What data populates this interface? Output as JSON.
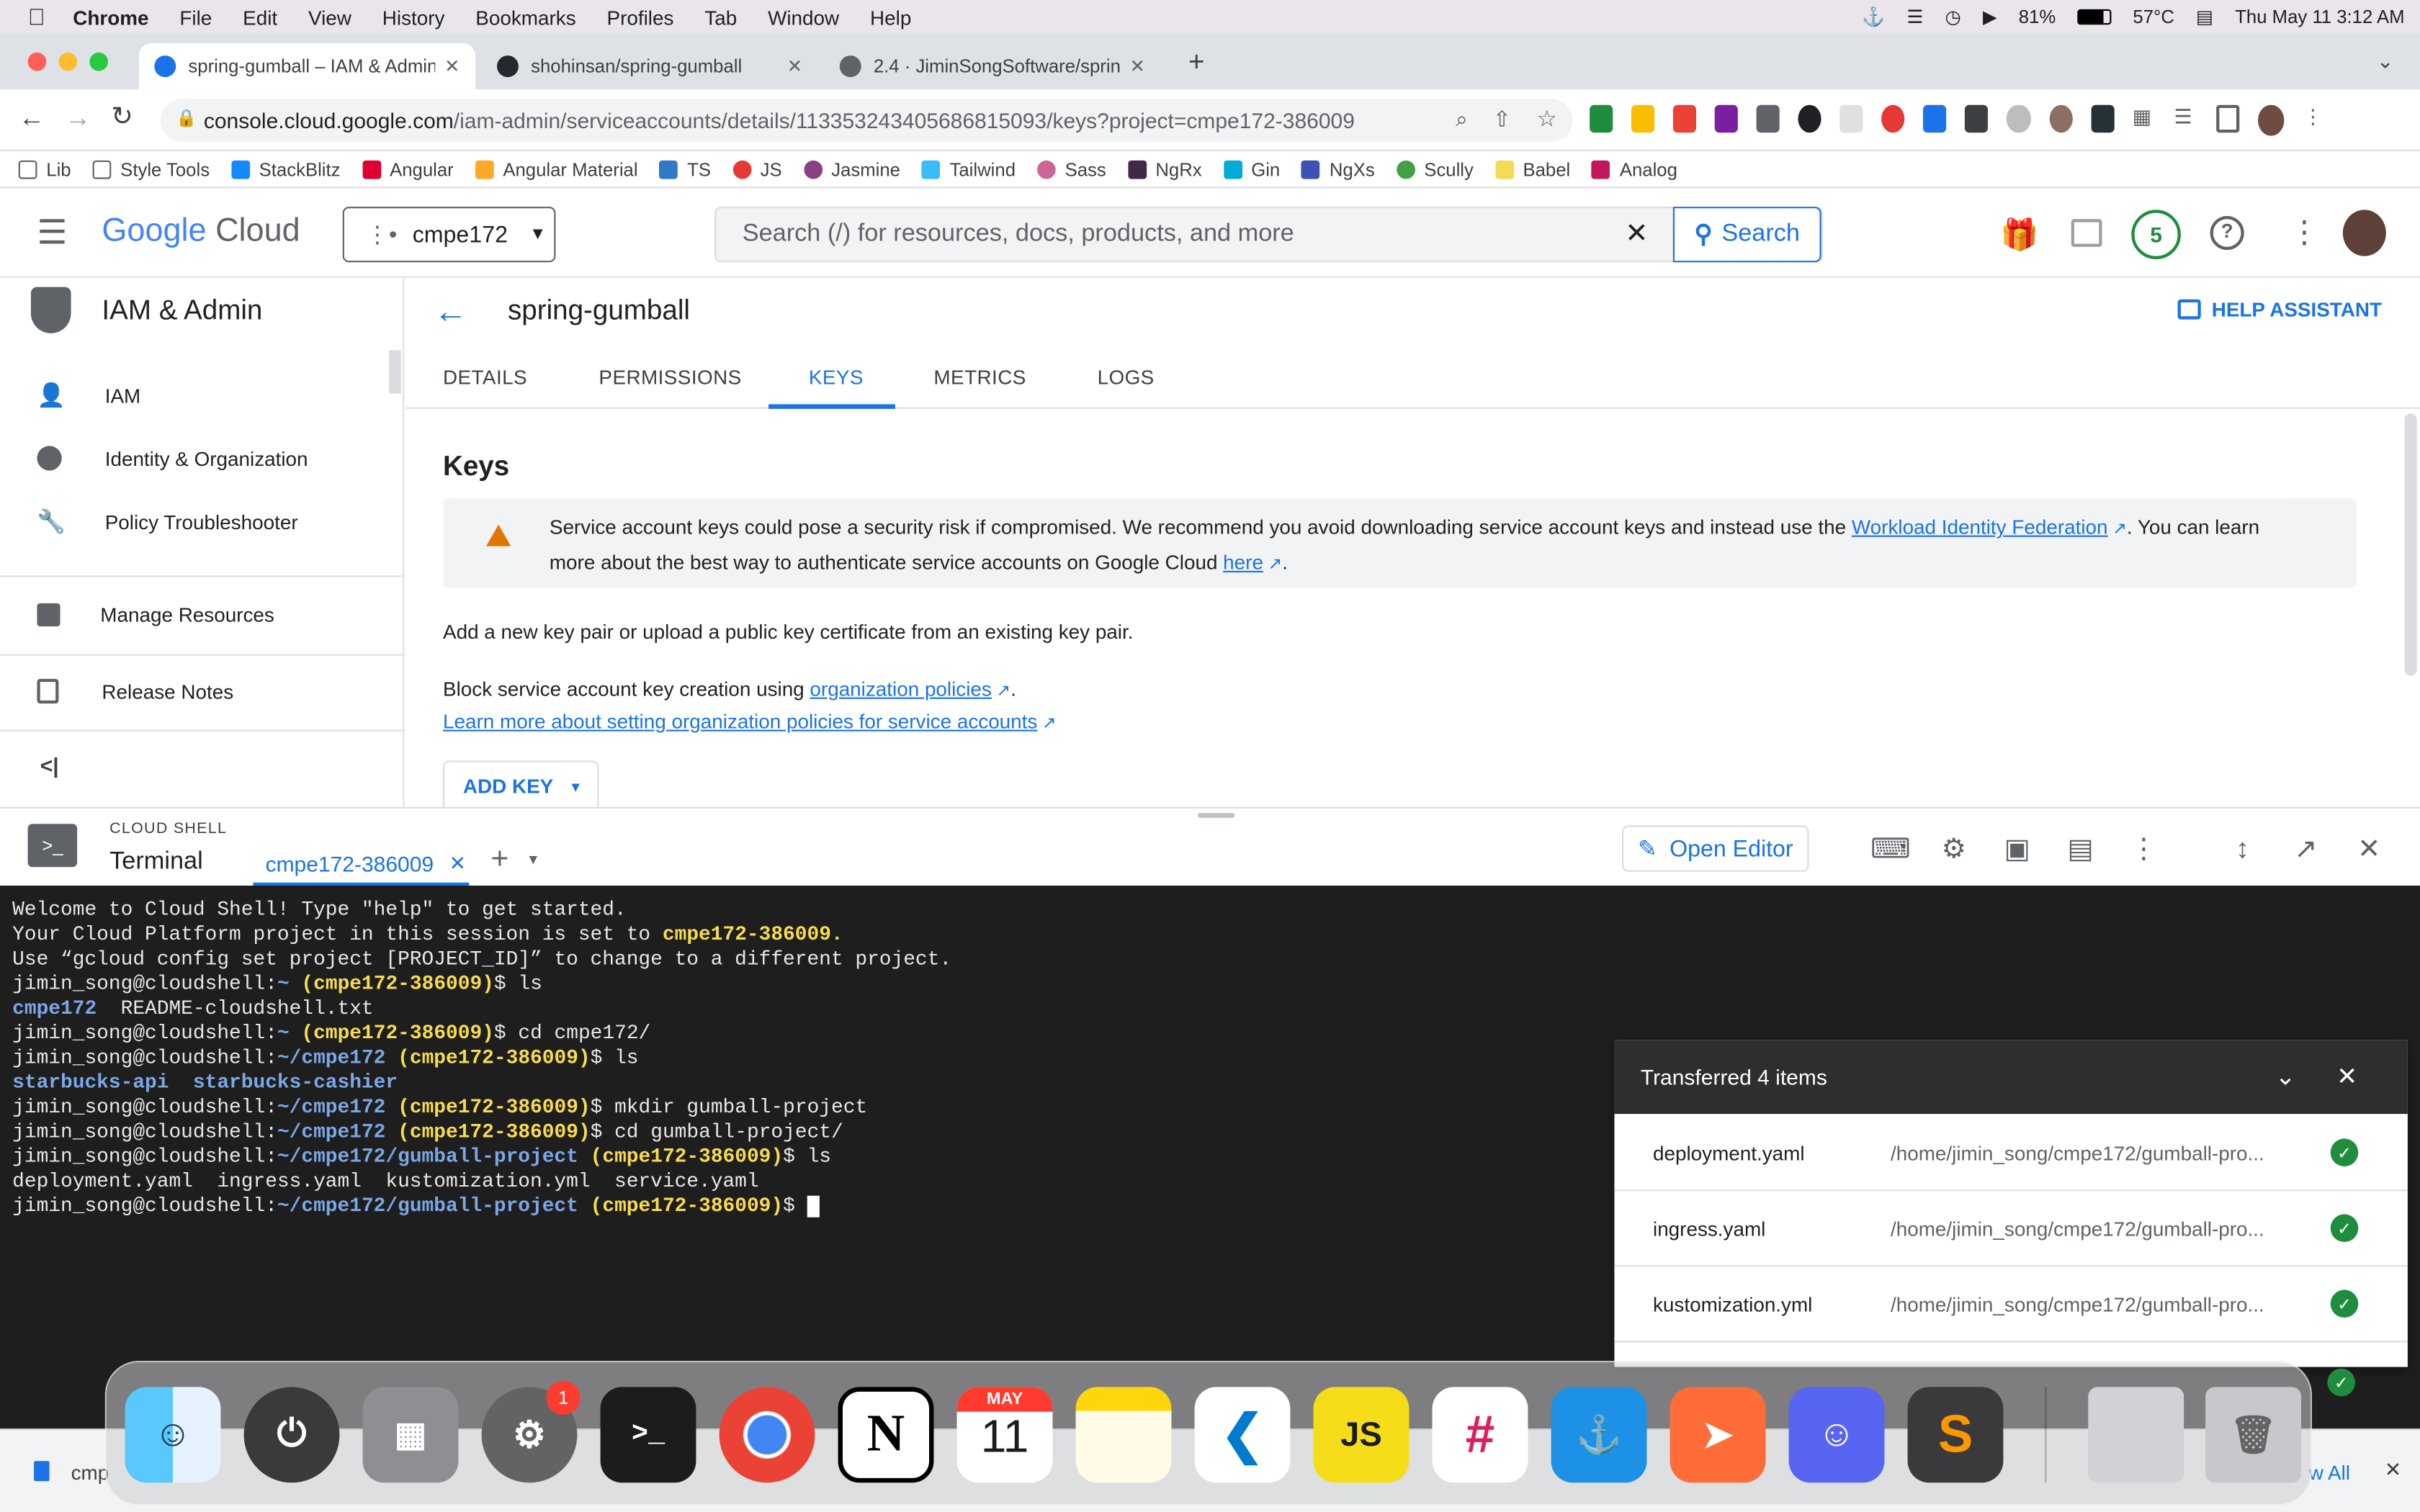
{
  "menubar": {
    "app": "Chrome",
    "items": [
      "File",
      "Edit",
      "View",
      "History",
      "Bookmarks",
      "Profiles",
      "Tab",
      "Window",
      "Help"
    ],
    "battery": "81%",
    "temp": "57°C",
    "datetime": "Thu May 11  3:12 AM"
  },
  "tabs": [
    {
      "title": "spring-gumball – IAM & Admin",
      "color": "#1a73e8"
    },
    {
      "title": "shohinsan/spring-gumball",
      "color": "#24292f"
    },
    {
      "title": "2.4 · JiminSongSoftware/spring",
      "color": "#5f6368"
    }
  ],
  "address": {
    "domain": "console.cloud.google.com",
    "path": "/iam-admin/serviceaccounts/details/113353243405686815093/keys?project=cmpe172-386009"
  },
  "bookmarks": [
    "Lib",
    "Style Tools",
    "StackBlitz",
    "Angular",
    "Angular Material",
    "TS",
    "JS",
    "Jasmine",
    "Tailwind",
    "Sass",
    "NgRx",
    "Gin",
    "NgXs",
    "Scully",
    "Babel",
    "Analog"
  ],
  "gcp": {
    "logo_google": "Google",
    "logo_cloud": "Cloud",
    "project": "cmpe172",
    "search_placeholder": "Search (/) for resources, docs, products, and more",
    "search_button": "Search",
    "notifications": "5"
  },
  "nav": {
    "title": "IAM & Admin",
    "items": [
      "IAM",
      "Identity & Organization",
      "Policy Troubleshooter",
      "Manage Resources",
      "Release Notes"
    ]
  },
  "page": {
    "title": "spring-gumball",
    "help": "HELP ASSISTANT",
    "tabs": [
      "DETAILS",
      "PERMISSIONS",
      "KEYS",
      "METRICS",
      "LOGS"
    ],
    "section": "Keys",
    "banner_text1": "Service account keys could pose a security risk if compromised. We recommend you avoid downloading service account keys and instead use the ",
    "banner_link1": "Workload Identity Federation",
    "banner_text2": ". You can learn",
    "banner_text3": "more about the best way to authenticate service accounts on Google Cloud ",
    "banner_link2": "here",
    "add_text": "Add a new key pair or upload a public key certificate from an existing key pair.",
    "block_text": "Block service account key creation using ",
    "block_link": "organization policies",
    "learn_link": "Learn more about setting organization policies for service accounts",
    "add_key": "ADD KEY"
  },
  "shell": {
    "label": "CLOUD SHELL",
    "title": "Terminal",
    "tab": "cmpe172-386009",
    "open_editor": "Open Editor"
  },
  "terminal": {
    "prompt_user": "jimin_song@cloudshell:",
    "project": "(cmpe172-386009)",
    "lines": {
      "l1": "Welcome to Cloud Shell! Type \"help\" to get started.",
      "l2a": "Your Cloud Platform project in this session is set to ",
      "l2b": "cmpe172-386009.",
      "l3": "Use “gcloud config set project [PROJECT_ID]” to change to a different project.",
      "c1": "ls",
      "o1a": "cmpe172",
      "o1b": "  README-cloudshell.txt",
      "c2": "cd cmpe172/",
      "c3": "ls",
      "o3": "starbucks-api  starbucks-cashier",
      "c4": "mkdir gumball-project",
      "c5": "cd gumball-project/",
      "c6": "ls",
      "o6": "deployment.yaml  ingress.yaml  kustomization.yml  service.yaml",
      "p_home": "~",
      "p_cmpe": "~/cmpe172",
      "p_gp": "~/cmpe172/gumball-project"
    }
  },
  "transfer": {
    "title": "Transferred 4 items",
    "files": [
      {
        "name": "deployment.yaml",
        "path": "/home/jimin_song/cmpe172/gumball-pro..."
      },
      {
        "name": "ingress.yaml",
        "path": "/home/jimin_song/cmpe172/gumball-pro..."
      },
      {
        "name": "kustomization.yml",
        "path": "/home/jimin_song/cmpe172/gumball-pro..."
      }
    ]
  },
  "dock": {
    "calendar_month": "MAY",
    "calendar_day": "11",
    "settings_badge": "1"
  },
  "bottom": {
    "left": "cmp",
    "right": "w All"
  }
}
